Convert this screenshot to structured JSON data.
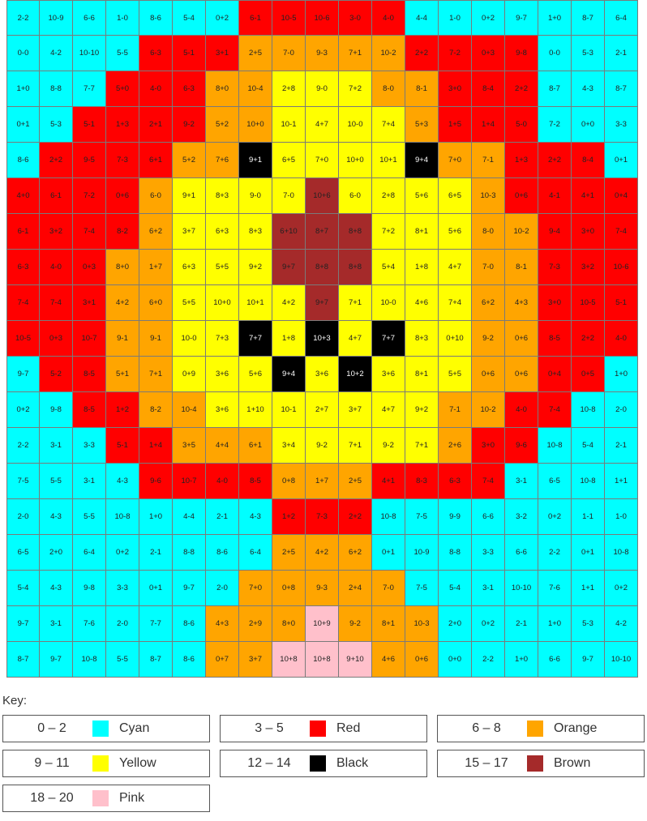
{
  "palette": {
    "C": "#00FFFF",
    "R": "#FF0000",
    "O": "#FFA500",
    "Y": "#FFFF00",
    "K": "#000000",
    "B": "#A52A2A",
    "P": "#FFC0CB"
  },
  "grid": {
    "rows": [
      [
        "2-2",
        "10-9",
        "6-6",
        "1-0",
        "8-6",
        "5-4",
        "0+2",
        "6-1",
        "10-5",
        "10-6",
        "3-0",
        "4-0",
        "4-4",
        "1-0",
        "0+2",
        "9-7",
        "1+0",
        "8-7",
        "6-4"
      ],
      [
        "0-0",
        "4-2",
        "10-10",
        "5-5",
        "6-3",
        "5-1",
        "3+1",
        "2+5",
        "7-0",
        "9-3",
        "7+1",
        "10-2",
        "2+2",
        "7-2",
        "0+3",
        "9-8",
        "0-0",
        "5-3",
        "2-1"
      ],
      [
        "1+0",
        "8-8",
        "7-7",
        "5+0",
        "4-0",
        "6-3",
        "8+0",
        "10-4",
        "2+8",
        "9-0",
        "7+2",
        "8-0",
        "8-1",
        "3+0",
        "8-4",
        "2+2",
        "8-7",
        "4-3",
        "8-7"
      ],
      [
        "0+1",
        "5-3",
        "5-1",
        "1+3",
        "2+1",
        "9-2",
        "5+2",
        "10+0",
        "10-1",
        "4+7",
        "10-0",
        "7+4",
        "5+3",
        "1+5",
        "1+4",
        "5-0",
        "7-2",
        "0+0",
        "3-3"
      ],
      [
        "8-6",
        "2+2",
        "9-5",
        "7-3",
        "6+1",
        "5+2",
        "7+6",
        "9+1",
        "6+5",
        "7+0",
        "10+0",
        "10+1",
        "9+4",
        "7+0",
        "7-1",
        "1+3",
        "2+2",
        "8-4",
        "0+1"
      ],
      [
        "4+0",
        "6-1",
        "7-2",
        "0+6",
        "6-0",
        "9+1",
        "8+3",
        "9-0",
        "7-0",
        "10+6",
        "6-0",
        "2+8",
        "5+6",
        "6+5",
        "10-3",
        "0+6",
        "4-1",
        "4+1",
        "0+4"
      ],
      [
        "6-1",
        "3+2",
        "7-4",
        "8-2",
        "6+2",
        "3+7",
        "6+3",
        "8+3",
        "6+10",
        "8+7",
        "8+8",
        "7+2",
        "8+1",
        "5+6",
        "8-0",
        "10-2",
        "9-4",
        "3+0",
        "7-4"
      ],
      [
        "6-3",
        "4-0",
        "0+3",
        "8+0",
        "1+7",
        "6+3",
        "5+5",
        "9+2",
        "9+7",
        "8+8",
        "8+8",
        "5+4",
        "1+8",
        "4+7",
        "7-0",
        "8-1",
        "7-3",
        "3+2",
        "10-6"
      ],
      [
        "7-4",
        "7-4",
        "3+1",
        "4+2",
        "6+0",
        "5+5",
        "10+0",
        "10+1",
        "4+2",
        "9+7",
        "7+1",
        "10-0",
        "4+6",
        "7+4",
        "6+2",
        "4+3",
        "3+0",
        "10-5",
        "5-1"
      ],
      [
        "10-5",
        "0+3",
        "10-7",
        "9-1",
        "9-1",
        "10-0",
        "7+3",
        "7+7",
        "1+8",
        "10+3",
        "4+7",
        "7+7",
        "8+3",
        "0+10",
        "9-2",
        "0+6",
        "8-5",
        "2+2",
        "4-0"
      ],
      [
        "9-7",
        "5-2",
        "8-5",
        "5+1",
        "7+1",
        "0+9",
        "3+6",
        "5+6",
        "9+4",
        "3+6",
        "10+2",
        "3+6",
        "8+1",
        "5+5",
        "0+6",
        "0+6",
        "0+4",
        "0+5",
        "1+0"
      ],
      [
        "0+2",
        "9-8",
        "8-5",
        "1+2",
        "8-2",
        "10-4",
        "3+6",
        "1+10",
        "10-1",
        "2+7",
        "3+7",
        "4+7",
        "9+2",
        "7-1",
        "10-2",
        "4-0",
        "7-4",
        "10-8",
        "2-0"
      ],
      [
        "2-2",
        "3-1",
        "3-3",
        "5-1",
        "1+4",
        "3+5",
        "4+4",
        "6+1",
        "3+4",
        "9-2",
        "7+1",
        "9-2",
        "7+1",
        "2+6",
        "3+0",
        "9-6",
        "10-8",
        "5-4",
        "2-1"
      ],
      [
        "7-5",
        "5-5",
        "3-1",
        "4-3",
        "9-6",
        "10-7",
        "4-0",
        "8-5",
        "0+8",
        "1+7",
        "2+5",
        "4+1",
        "8-3",
        "6-3",
        "7-4",
        "3-1",
        "6-5",
        "10-8",
        "1+1"
      ],
      [
        "2-0",
        "4-3",
        "5-5",
        "10-8",
        "1+0",
        "4-4",
        "2-1",
        "4-3",
        "1+2",
        "7-3",
        "2+2",
        "10-8",
        "7-5",
        "9-9",
        "6-6",
        "3-2",
        "0+2",
        "1-1",
        "1-0"
      ],
      [
        "6-5",
        "2+0",
        "6-4",
        "0+2",
        "2-1",
        "8-8",
        "8-6",
        "6-4",
        "2+5",
        "4+2",
        "6+2",
        "0+1",
        "10-9",
        "8-8",
        "3-3",
        "6-6",
        "2-2",
        "0+1",
        "10-8"
      ],
      [
        "5-4",
        "4-3",
        "9-8",
        "3-3",
        "0+1",
        "9-7",
        "2-0",
        "7+0",
        "0+8",
        "9-3",
        "2+4",
        "7-0",
        "7-5",
        "5-4",
        "3-1",
        "10-10",
        "7-6",
        "1+1",
        "0+2"
      ],
      [
        "9-7",
        "3-1",
        "7-6",
        "2-0",
        "7-7",
        "8-6",
        "4+3",
        "2+9",
        "8+0",
        "10+9",
        "9-2",
        "8+1",
        "10-3",
        "2+0",
        "0+2",
        "2-1",
        "1+0",
        "5-3",
        "4-2"
      ],
      [
        "8-7",
        "9-7",
        "10-8",
        "5-5",
        "8-7",
        "8-6",
        "0+7",
        "3+7",
        "10+8",
        "10+8",
        "9+10",
        "4+6",
        "0+6",
        "0+0",
        "2-2",
        "1+0",
        "6-6",
        "9-7",
        "10-10"
      ]
    ],
    "colors": [
      "CCCCCCCRRRRRCCCCCCC",
      "CCCCRRROOOOORRRRCCC",
      "CCCRRROOYYYOORRRCCC",
      "CCRRRROOYYYYORRRCCC",
      "CRRRROOKYYYYKOORRRC",
      "RRRROYYYYBYYYYORRRR",
      "RRRROYYYBBBYYYOORRR",
      "RRROOYYYBBBYYYOORRR",
      "RRROOYYYYBYYYYOORRR",
      "RRROOYYKYKYKYYOORRR",
      "CRROOYYYKYKYYYOORRC",
      "CCRROOYYYYYYYOORRCC",
      "CCCRROOOYYYYYORRCCC",
      "CCCCRRRROOORRRRCCCC",
      "CCCCCCCCRRRCCCCCCCC",
      "CCCCCCCCOOOCCCCCCCC",
      "CCCCCCCOOOOOCCCCCCC",
      "CCCCCCOOOPOOOCCCCCC",
      "CCCCCCOOPPPOOCCCCCC"
    ]
  },
  "key": {
    "label": "Key:",
    "entries": [
      {
        "range": "0 – 2",
        "name": "Cyan",
        "color": "#00FFFF"
      },
      {
        "range": "3 – 5",
        "name": "Red",
        "color": "#FF0000"
      },
      {
        "range": "6 – 8",
        "name": "Orange",
        "color": "#FFA500"
      },
      {
        "range": "9 – 11",
        "name": "Yellow",
        "color": "#FFFF00"
      },
      {
        "range": "12 – 14",
        "name": "Black",
        "color": "#000000"
      },
      {
        "range": "15 – 17",
        "name": "Brown",
        "color": "#A52A2A"
      },
      {
        "range": "18 – 20",
        "name": "Pink",
        "color": "#FFC0CB"
      }
    ]
  }
}
